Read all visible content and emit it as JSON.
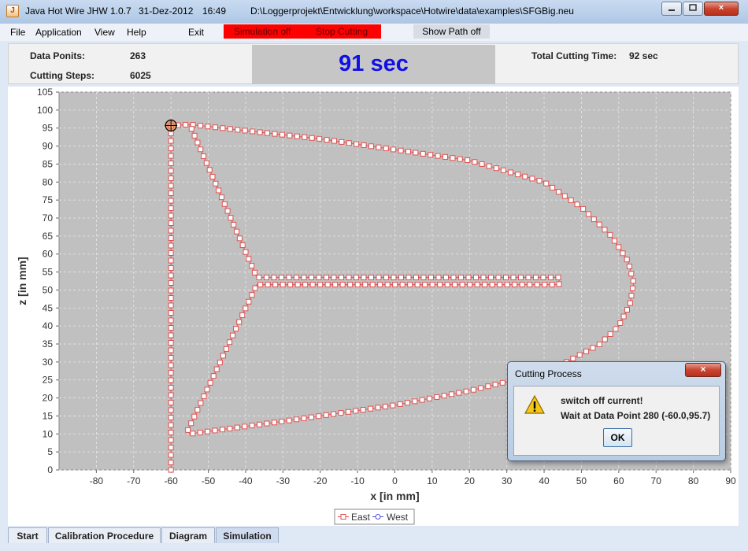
{
  "window": {
    "title": "Java Hot Wire JHW 1.0.7",
    "date": "31-Dez-2012",
    "time": "16:49",
    "path": "D:\\Loggerprojekt\\Entwicklung\\workspace\\Hotwire\\data\\examples\\SFGBig.neu",
    "close_glyph": "×"
  },
  "menu": {
    "file": "File",
    "application": "Application",
    "view": "View",
    "help": "Help",
    "exit": "Exit",
    "simulation": "Simulation off",
    "stop_cutting": "Stop Cutting",
    "show_path": "Show Path off"
  },
  "info": {
    "data_points_label": "Data Ponits:",
    "data_points_value": "263",
    "cutting_steps_label": "Cutting Steps:",
    "cutting_steps_value": "6025",
    "timer": "91 sec",
    "total_label": "Total Cutting Time:",
    "total_value": "92 sec"
  },
  "chart_data": {
    "type": "line",
    "xlabel": "x [in mm]",
    "ylabel": "z [in mm]",
    "xlim": [
      -90,
      90
    ],
    "ylim": [
      0,
      105
    ],
    "xticks": [
      -80,
      -70,
      -60,
      -50,
      -40,
      -30,
      -20,
      -10,
      0,
      10,
      20,
      30,
      40,
      50,
      60,
      70,
      80,
      90
    ],
    "yticks": [
      0,
      5,
      10,
      15,
      20,
      25,
      30,
      35,
      40,
      45,
      50,
      55,
      60,
      65,
      70,
      75,
      80,
      85,
      90,
      95,
      100,
      105
    ],
    "grid": true,
    "legend": "bottom-center",
    "series": [
      {
        "name": "East",
        "color": "#e05050",
        "marker": "square",
        "path": [
          [
            -60,
            0
          ],
          [
            -60,
            95.7
          ],
          [
            -55,
            96
          ],
          [
            -20,
            92
          ],
          [
            20,
            86
          ],
          [
            40,
            80
          ],
          [
            50,
            73
          ],
          [
            58,
            65
          ],
          [
            62.5,
            58
          ],
          [
            64,
            52
          ],
          [
            63,
            46
          ],
          [
            60,
            40
          ],
          [
            55,
            35
          ],
          [
            46,
            30
          ],
          [
            36,
            26
          ],
          [
            20,
            22
          ],
          [
            0,
            18
          ],
          [
            -30,
            13.5
          ],
          [
            -55,
            10
          ],
          [
            -55.5,
            11
          ],
          [
            -37,
            51.5
          ],
          [
            44,
            51.5
          ],
          [
            44,
            53.5
          ],
          [
            -37,
            53.5
          ],
          [
            -55,
            96
          ]
        ]
      },
      {
        "name": "West",
        "color": "#5050e0",
        "marker": "circle"
      }
    ],
    "current_point": [
      -60,
      95.7
    ]
  },
  "tabs": [
    "Start",
    "Calibration Procedure",
    "Diagram",
    "Simulation"
  ],
  "dialog": {
    "title": "Cutting Process",
    "message1": "switch off current!",
    "message2": "Wait at Data Point 280 (-60.0,95.7)",
    "ok": "OK",
    "close_glyph": "×",
    "icon": "warning-icon"
  }
}
